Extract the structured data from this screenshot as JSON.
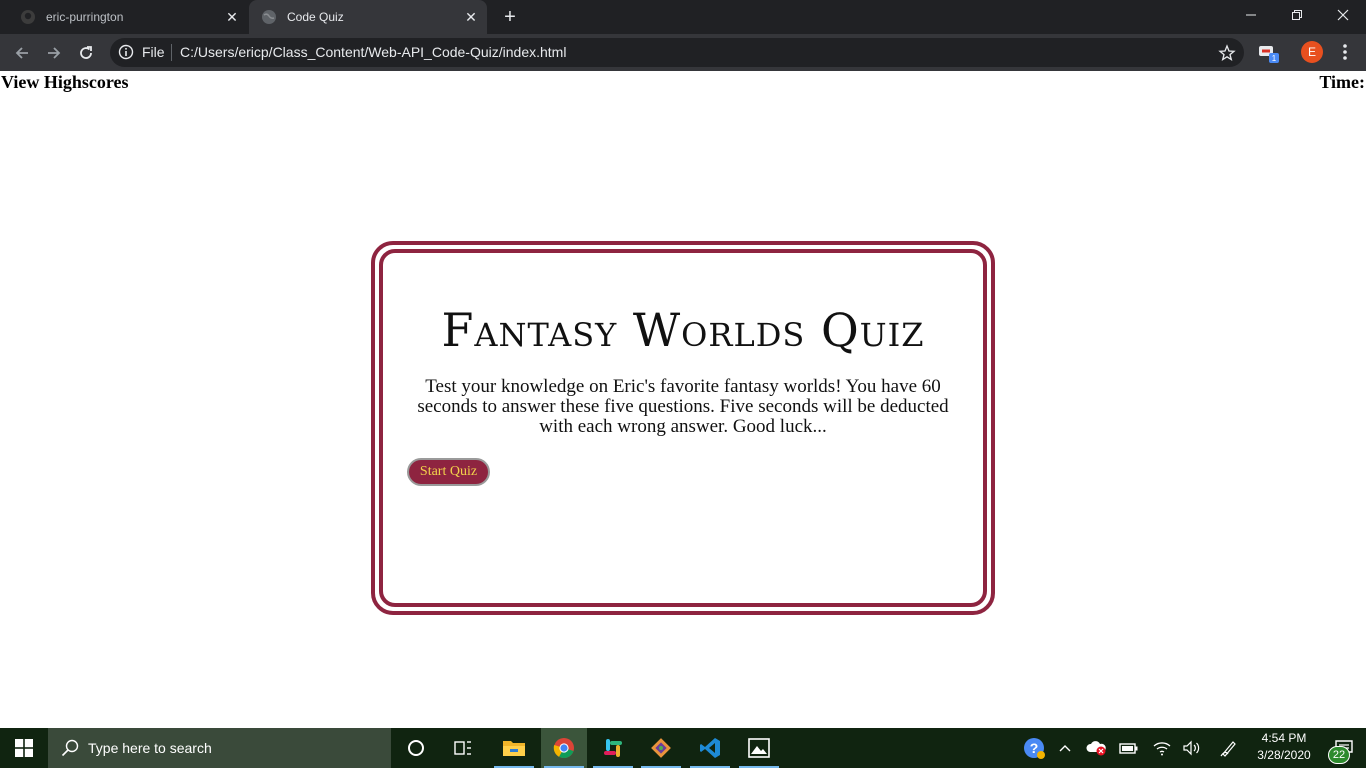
{
  "browser": {
    "tabs": [
      {
        "title": "eric-purrington",
        "favicon": "github-icon"
      },
      {
        "title": "Code Quiz",
        "favicon": "globe-icon"
      }
    ],
    "address": {
      "protocol_label": "File",
      "url": "C:/Users/ericp/Class_Content/Web-API_Code-Quiz/index.html"
    },
    "profile_initial": "E",
    "extension_badge": "1"
  },
  "page": {
    "highscores_link": "View Highscores",
    "timer_label": "Time:",
    "quiz": {
      "title": "Fantasy Worlds Quiz",
      "description": "Test your knowledge on Eric's favorite fantasy worlds! You have 60 seconds to answer these five questions. Five seconds will be deducted with each wrong answer. Good luck...",
      "start_button": "Start Quiz"
    },
    "colors": {
      "accent": "#8e2440",
      "button_text": "#f2d24b"
    }
  },
  "taskbar": {
    "search_placeholder": "Type here to search",
    "apps": [
      "cortana-icon",
      "task-view-icon",
      "file-explorer-icon",
      "chrome-icon",
      "slack-icon",
      "git-icon",
      "vscode-icon",
      "photos-icon"
    ],
    "clock": {
      "time": "4:54 PM",
      "date": "3/28/2020"
    },
    "notification_count": "22"
  }
}
